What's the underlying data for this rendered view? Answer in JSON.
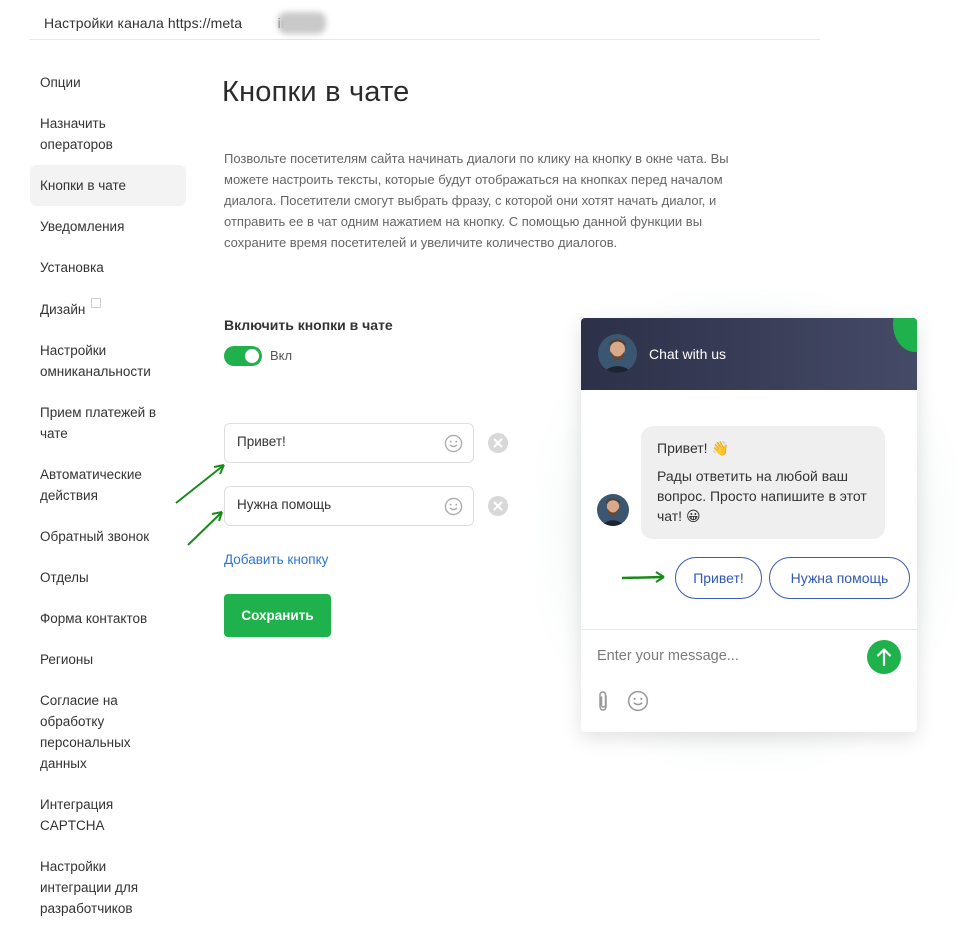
{
  "topbar": {
    "title": "Настройки канала https://meta",
    "title_suffix": "info"
  },
  "sidebar": {
    "items": [
      {
        "label": "Опции"
      },
      {
        "label": "Назначить операторов"
      },
      {
        "label": "Кнопки в чате"
      },
      {
        "label": "Уведомления"
      },
      {
        "label": "Установка"
      },
      {
        "label": "Дизайн"
      },
      {
        "label": "Настройки омниканальности"
      },
      {
        "label": "Прием платежей в чате"
      },
      {
        "label": "Автоматические действия"
      },
      {
        "label": "Обратный звонок"
      },
      {
        "label": "Отделы"
      },
      {
        "label": "Форма контактов"
      },
      {
        "label": "Регионы"
      },
      {
        "label": "Согласие на обработку персональных данных"
      },
      {
        "label": "Интеграция CAPTCHA"
      },
      {
        "label": "Настройки интеграции для разработчиков"
      }
    ],
    "active": "Кнопки в чате",
    "external_icon": "external-link-icon"
  },
  "main": {
    "title": "Кнопки в чате",
    "description": "Позвольте посетителям сайта начинать диалоги по клику на кнопку в окне чата. Вы можете настроить тексты, которые будут отображаться на кнопках перед началом диалога. Посетители смогут выбрать фразу, с которой они хотят начать диалог, и отправить ее в чат одним нажатием на кнопку. С помощью данной функции вы сохраните время посетителей и увеличите количество диалогов.",
    "toggle_section_label": "Включить кнопки в чате",
    "toggle_state_label": "Вкл",
    "toggle_on": true,
    "buttons": [
      {
        "value": "Привет!"
      },
      {
        "value": "Нужна помощь"
      }
    ],
    "add_button_label": "Добавить кнопку",
    "save_label": "Сохранить"
  },
  "widget": {
    "header_title": "Chat with us",
    "message_line1": "Привет! 👋",
    "message_line2": "Рады ответить на любой ваш вопрос. Просто напишите в этот чат! 😀",
    "quick_replies": [
      "Привет!",
      "Нужна помощь"
    ],
    "input_placeholder": "Enter your message...",
    "icons": [
      "paperclip-icon",
      "smile-icon",
      "send-arrow-icon"
    ]
  },
  "colors": {
    "accent_green": "#1fb14b",
    "link_blue": "#2d74d6",
    "widget_header": "#2c3048",
    "annotation_arrow": "#1a8a1a"
  }
}
